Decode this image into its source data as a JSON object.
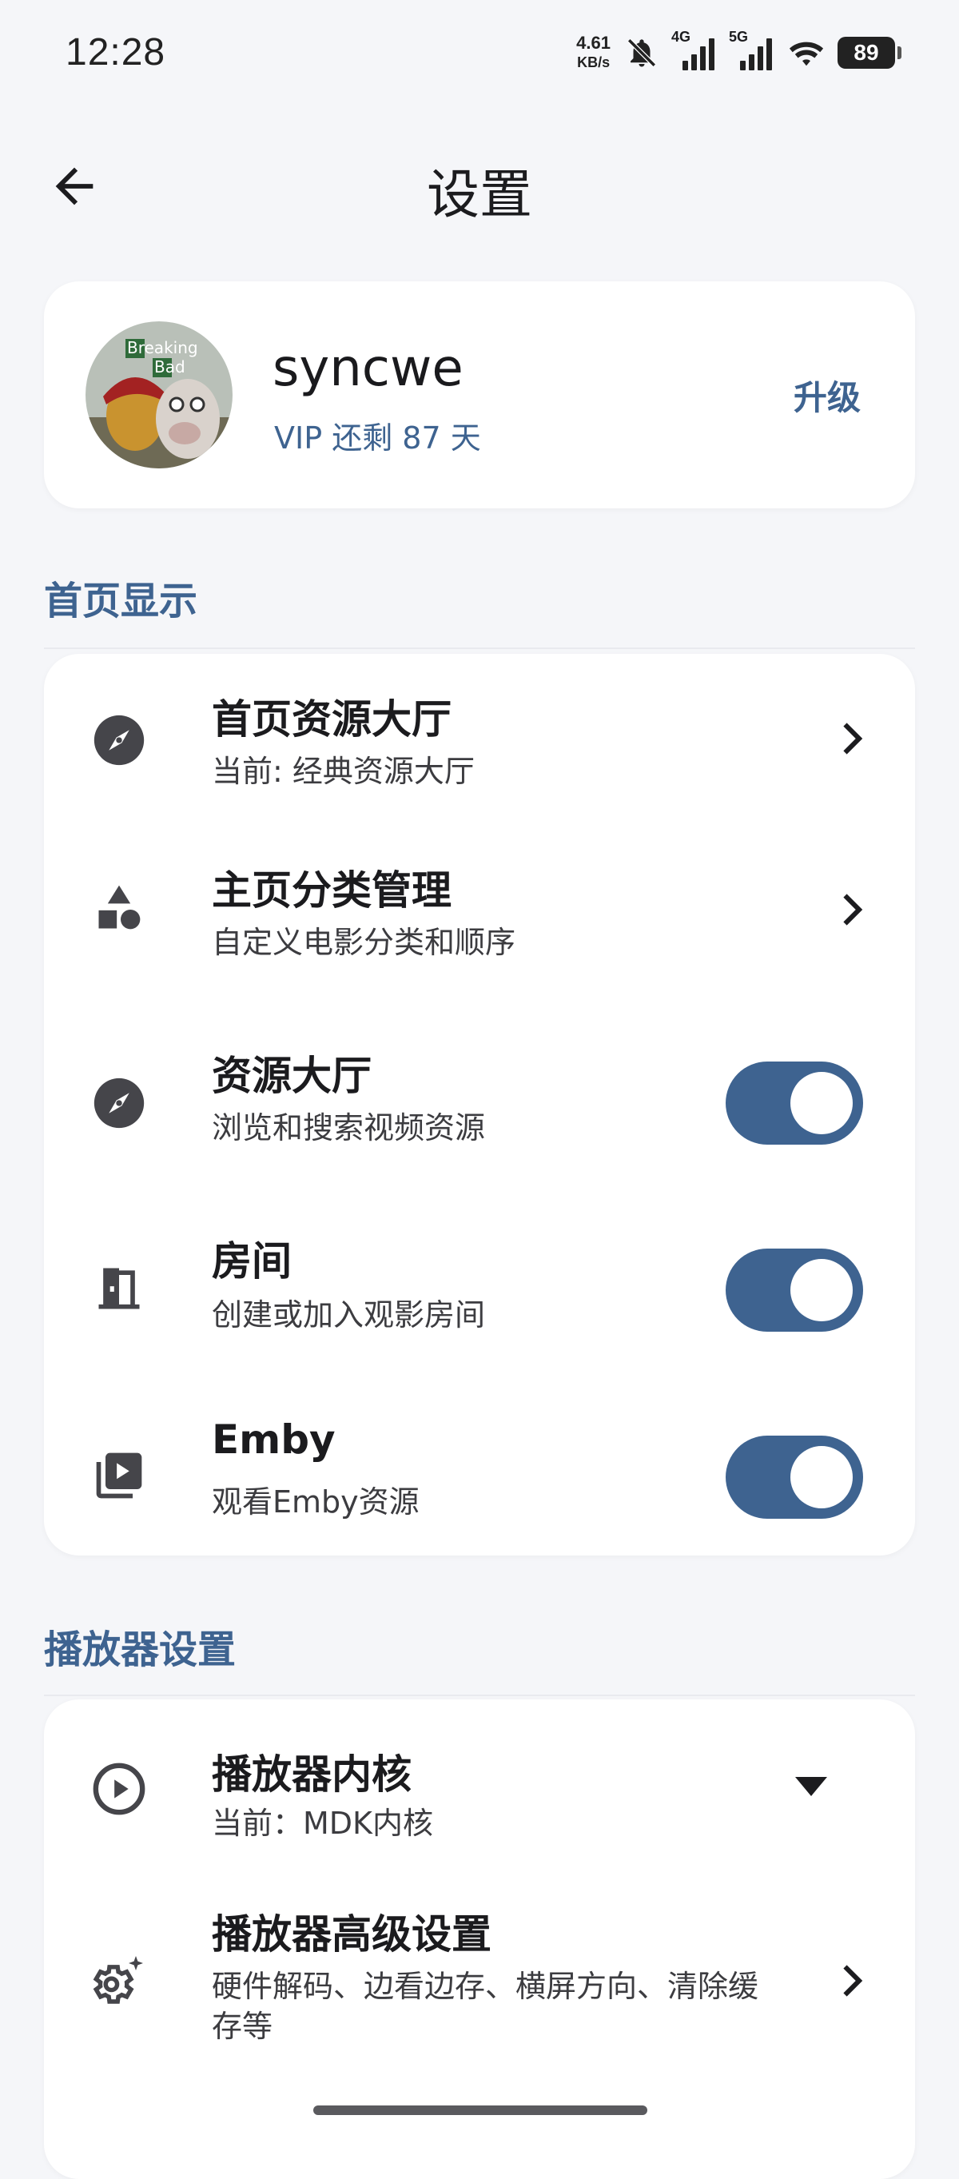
{
  "status_bar": {
    "time": "12:28",
    "net_speed": "4.61",
    "net_unit": "KB/s",
    "sig1_label": "4G",
    "sig2_label": "5G",
    "battery": "89"
  },
  "header": {
    "title": "设置"
  },
  "profile": {
    "username": "syncwe",
    "vip_status": "VIP 还剩 87 天",
    "upgrade_label": "升级",
    "avatar_text_1": "Breaking",
    "avatar_text_2": "Bad"
  },
  "sections": {
    "home": {
      "title": "首页显示",
      "items": [
        {
          "title": "首页资源大厅",
          "subtitle": "当前: 经典资源大厅",
          "icon": "compass-icon",
          "control": "chevron"
        },
        {
          "title": "主页分类管理",
          "subtitle": "自定义电影分类和顺序",
          "icon": "category-shapes-icon",
          "control": "chevron"
        },
        {
          "title": "资源大厅",
          "subtitle": "浏览和搜索视频资源",
          "icon": "compass-icon",
          "control": "toggle",
          "on": true
        },
        {
          "title": "房间",
          "subtitle": "创建或加入观影房间",
          "icon": "door-icon",
          "control": "toggle",
          "on": true
        },
        {
          "title": "Emby",
          "subtitle": "观看Emby资源",
          "icon": "video-library-icon",
          "control": "toggle",
          "on": true
        }
      ]
    },
    "player": {
      "title": "播放器设置",
      "items": [
        {
          "title": "播放器内核",
          "subtitle": "当前：MDK内核",
          "icon": "play-circle-icon",
          "control": "dropdown"
        },
        {
          "title": "播放器高级设置",
          "subtitle_line1": "硬件解码、边看边存、横屏方向、清除缓",
          "subtitle_line2": "存等",
          "icon": "gear-sparkle-icon",
          "control": "chevron"
        }
      ]
    }
  },
  "colors": {
    "accent": "#3e6390",
    "background": "#f5f6f9",
    "card": "#ffffff"
  }
}
